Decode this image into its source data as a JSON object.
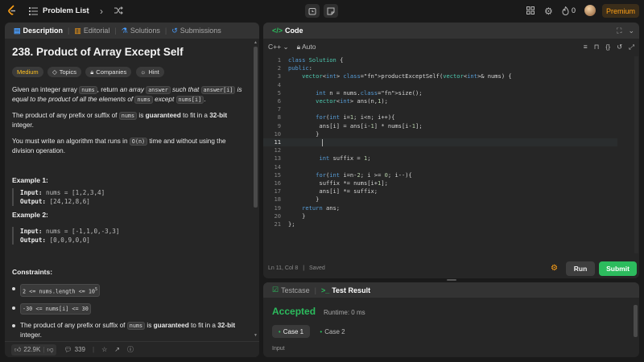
{
  "topbar": {
    "problem_list": "Problem List",
    "streak": "0",
    "premium": "Premium"
  },
  "left_tabs": {
    "description": "Description",
    "editorial": "Editorial",
    "solutions": "Solutions",
    "submissions": "Submissions"
  },
  "problem": {
    "title": "238. Product of Array Except Self",
    "difficulty": "Medium",
    "topics": "Topics",
    "companies": "Companies",
    "hint": "Hint",
    "p1_a": "Given an integer array ",
    "p1_nums": "nums",
    "p1_b": ", return ",
    "p1_c": "an array ",
    "p1_answer": "answer",
    "p1_d": " such that ",
    "p1_answer_i": "answer[i]",
    "p1_e": " is equal to the product of all the elements of ",
    "p1_nums2": "nums",
    "p1_f": " except ",
    "p1_nums_i": "nums[i]",
    "p1_g": ".",
    "p2_a": "The product of any prefix or suffix of ",
    "p2_nums": "nums",
    "p2_b": " is ",
    "p2_guaranteed": "guaranteed",
    "p2_c": " to fit in a ",
    "p2_bit": "32-bit",
    "p2_d": " integer.",
    "p3_a": "You must write an algorithm that runs in ",
    "p3_on": "O(n)",
    "p3_b": " time and without using the division operation.",
    "ex1_title": "Example 1:",
    "ex1_input_label": "Input:",
    "ex1_input": " nums = [1,2,3,4]",
    "ex1_output_label": "Output:",
    "ex1_output": " [24,12,8,6]",
    "ex2_title": "Example 2:",
    "ex2_input_label": "Input:",
    "ex2_input": " nums = [-1,1,0,-3,3]",
    "ex2_output_label": "Output:",
    "ex2_output": " [0,0,9,0,0]",
    "constraints_title": "Constraints:",
    "c1_a": "2 <= nums.length <= 10",
    "c1_sup": "5",
    "c2": "-30 <= nums[i] <= 30",
    "c3_a": "The product of any prefix or suffix of ",
    "c3_nums": "nums",
    "c3_b": " is ",
    "c3_guaranteed": "guaranteed",
    "c3_c": " to fit in a ",
    "c3_bit": "32-bit",
    "c3_d": " integer."
  },
  "left_footer": {
    "likes": "22.9K",
    "comments": "339"
  },
  "code_panel": {
    "tab": "Code",
    "language": "C++",
    "auto": "Auto",
    "status_pos": "Ln 11, Col 8",
    "status_saved": "Saved",
    "run": "Run",
    "submit": "Submit"
  },
  "code_lines": [
    "class Solution {",
    "public:",
    "    vector<int> productExceptSelf(vector<int>& nums) {",
    "",
    "        int n = nums.size();",
    "        vector<int> ans(n,1);",
    "",
    "        for(int i=1; i<n; i++){",
    "         ans[i] = ans[i-1] * nums[i-1];",
    "        }",
    "        ",
    "",
    "         int suffix = 1;",
    "",
    "        for(int i=n-2; i >= 0; i--){",
    "         suffix *= nums[i+1];",
    "         ans[i] *= suffix;",
    "        }",
    "    return ans;",
    "    }",
    "};"
  ],
  "result_panel": {
    "testcase": "Testcase",
    "test_result": "Test Result",
    "accepted": "Accepted",
    "runtime": "Runtime: 0 ms",
    "case1": "Case 1",
    "case2": "Case 2",
    "input_label": "Input"
  },
  "colors": {
    "accent_orange": "#ffa116",
    "accepted_green": "#2cbb5d",
    "medium_yellow": "#ffc01e"
  }
}
